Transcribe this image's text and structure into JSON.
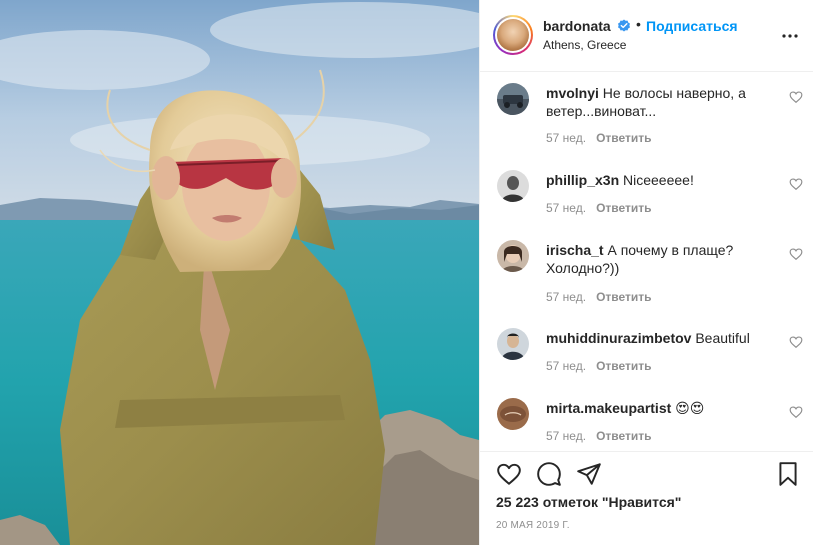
{
  "post": {
    "username": "bardonata",
    "follow_label": "Подписаться",
    "dot": "•",
    "location": "Athens, Greece",
    "likes_text": "25 223 отметок \"Нравится\"",
    "date_text": "20 МАЯ 2019 Г."
  },
  "comments": [
    {
      "user": "mvolnyi",
      "text": "Не волосы наверно, а ветер...виноват...",
      "age": "57 нед.",
      "reply": "Ответить",
      "avatar": "outdoor-photo"
    },
    {
      "user": "phillip_x3n",
      "text": "Niceeeeee!",
      "age": "57 нед.",
      "reply": "Ответить",
      "avatar": "portrait-bw"
    },
    {
      "user": "irischa_t",
      "text": "А почему в плаще? Холодно?))",
      "age": "57 нед.",
      "reply": "Ответить",
      "avatar": "portrait-woman"
    },
    {
      "user": "muhiddinurazimbetov",
      "text": "Beautiful",
      "age": "57 нед.",
      "reply": "Ответить",
      "avatar": "portrait-man"
    },
    {
      "user": "mirta.makeupartist",
      "text": "😍😍",
      "age": "57 нед.",
      "reply": "Ответить",
      "avatar": "logo-brown"
    }
  ],
  "icons": {
    "verified": "verified-badge-icon",
    "more": "more-options-icon",
    "heart": "heart-outline-icon",
    "comment": "comment-bubble-icon",
    "share": "paper-plane-icon",
    "save": "bookmark-icon"
  },
  "colors": {
    "link": "#0095f6",
    "text": "#262626",
    "muted": "#8e8e8e"
  }
}
